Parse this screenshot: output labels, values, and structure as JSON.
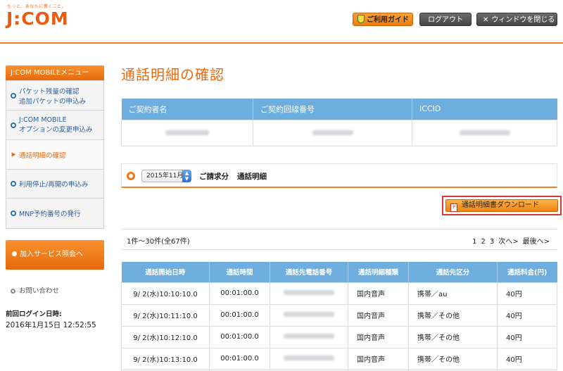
{
  "header": {
    "tagline": "もっと、あなたに響くこと。",
    "logo": "J:COM",
    "guide_label": "ご利用ガイド",
    "logout_label": "ログアウト",
    "close_label": "ウィンドウを閉じる"
  },
  "sidebar": {
    "menu_title": "J:COM MOBILEメニュー",
    "items": [
      {
        "line1": "パケット残量の確認",
        "line2": "追加パケットの申込み"
      },
      {
        "line1": "J:COM MOBILE",
        "line2": "オプションの変更申込み"
      },
      {
        "line1": "通話明細の確認",
        "line2": ""
      },
      {
        "line1": "利用停止/再開の申込み",
        "line2": ""
      },
      {
        "line1": "MNP予約番号の発行",
        "line2": ""
      }
    ],
    "service_button": "加入サービス照会へ",
    "contact_label": "お問い合わせ",
    "last_login_label": "前回ログイン日時:",
    "last_login_value": "2016年1月15日 12:52:55"
  },
  "main": {
    "title": "通話明細の確認",
    "contract_headers": [
      "ご契約者名",
      "ご契約回線番号",
      "ICCID"
    ],
    "period_select": "2015年11月",
    "period_billing": "ご請求分",
    "period_detail": "通話明細",
    "download_label": "通話明細書ダウンロード",
    "count_text": "1件～30件(全67件)",
    "pager": {
      "pages": [
        "1",
        "2",
        "3"
      ],
      "next": "次へ>",
      "last": "最後へ>"
    },
    "call_headers": [
      "通話開始日時",
      "通話時間",
      "通話先電話番号",
      "通話明細種類",
      "通話先区分",
      "通話料金(円)"
    ],
    "call_rows": [
      {
        "start": "9/ 2(水)10:10:10.0",
        "duration": "00:01:00.0",
        "type": "国内音声",
        "category": "携帯／au",
        "fee": "40円"
      },
      {
        "start": "9/ 2(水)10:11:10.0",
        "duration": "00:01:00.0",
        "type": "国内音声",
        "category": "携帯／その他",
        "fee": "40円"
      },
      {
        "start": "9/ 2(水)10:12:10.0",
        "duration": "00:01:00.0",
        "type": "国内音声",
        "category": "携帯／その他",
        "fee": "40円"
      },
      {
        "start": "9/ 2(水)10:13:10.0",
        "duration": "00:01:00.0",
        "type": "国内音声",
        "category": "携帯／その他",
        "fee": "40円"
      }
    ]
  },
  "colors": {
    "accent": "#e8690c",
    "table_header": "#6eaedf",
    "link": "#2a5fa3"
  }
}
